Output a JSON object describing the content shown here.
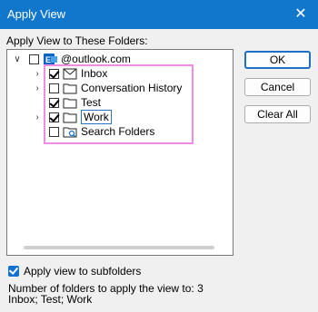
{
  "window": {
    "title": "Apply View",
    "close_glyph": "✕"
  },
  "tree": {
    "label": "Apply View to These Folders:",
    "items": [
      {
        "label": "@outlook.com",
        "checked": false,
        "icon": "outlook-account-icon"
      },
      {
        "label": "Inbox",
        "checked": true,
        "icon": "envelope-icon"
      },
      {
        "label": "Conversation History",
        "checked": false,
        "icon": "folder-icon"
      },
      {
        "label": "Test",
        "checked": true,
        "icon": "folder-icon"
      },
      {
        "label": "Work",
        "checked": true,
        "icon": "folder-icon"
      },
      {
        "label": "Search Folders",
        "checked": false,
        "icon": "search-folder-icon"
      }
    ]
  },
  "buttons": {
    "ok": "OK",
    "cancel": "Cancel",
    "clear_all": "Clear All"
  },
  "subfolders": {
    "label": "Apply view to subfolders",
    "checked": true
  },
  "summary": {
    "count_text": "Number of folders to apply the view to: 3",
    "list_text": "Inbox; Test; Work"
  },
  "colors": {
    "titlebar": "#1177cc",
    "highlight": "#f08be8",
    "accent": "#1172d3"
  }
}
